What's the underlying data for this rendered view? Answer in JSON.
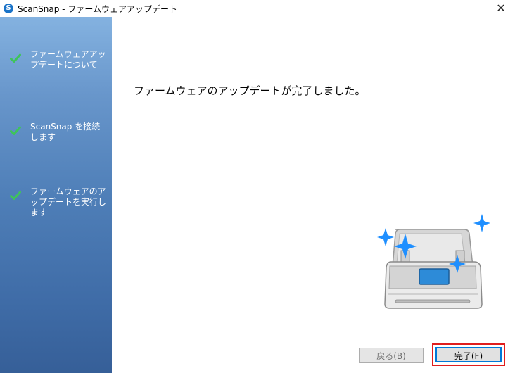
{
  "window": {
    "title": "ScanSnap - ファームウェアアップデート",
    "app_icon": "scansnap-logo-icon",
    "close_glyph": "✕"
  },
  "sidebar": {
    "steps": [
      {
        "label": "ファームウェアアップデートについて",
        "completed": true,
        "icon": "checkmark-icon"
      },
      {
        "label": "ScanSnap を接続します",
        "completed": true,
        "icon": "checkmark-icon"
      },
      {
        "label": "ファームウェアのアップデートを実行します",
        "completed": true,
        "icon": "checkmark-icon"
      }
    ],
    "check_color": "#3ec45a"
  },
  "main": {
    "message": "ファームウェアのアップデートが完了しました。",
    "illustration": "scanner-sparkle-illustration"
  },
  "buttons": {
    "back_label": "戻る(B)",
    "back_enabled": false,
    "finish_label": "完了(F)",
    "finish_highlight_color": "#e01d1d",
    "accent": "#0078d7"
  }
}
